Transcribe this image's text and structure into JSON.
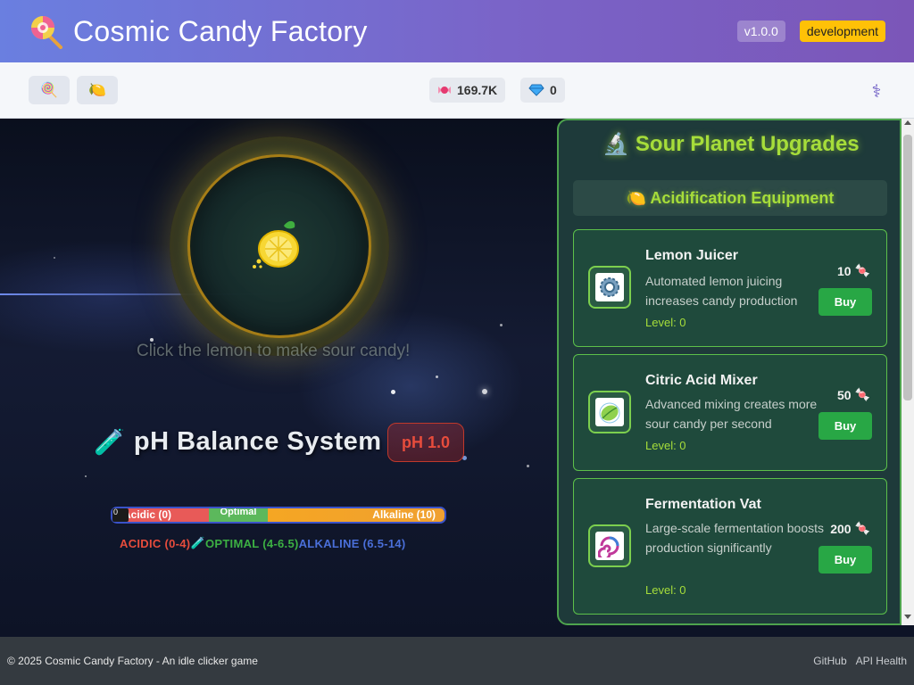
{
  "app": {
    "title": "Cosmic Candy Factory",
    "version": "v1.0.0",
    "environment": "development"
  },
  "toolbar": {
    "planets": [
      {
        "icon": "lollipop-icon",
        "glyph": "🍭"
      },
      {
        "icon": "lemon-icon",
        "glyph": "🍋"
      }
    ],
    "candy_count": "169.7K",
    "gem_count": "0",
    "settings_icon": "caduceus-icon"
  },
  "game": {
    "hint": "Click the lemon to make sour candy!",
    "ph_system": {
      "title": "pH Balance System",
      "value_label": "pH 1.0",
      "ph_value": 1.0,
      "bar_acidic": "Acidic (0)",
      "bar_optimal": "Optimal",
      "bar_alkaline": "Alkaline (10)",
      "marker_text": "0",
      "legend_acidic": "ACIDIC (0-4)",
      "legend_optimal": "OPTIMAL (4-6.5)",
      "legend_alkaline": "ALKALINE (6.5-14)"
    }
  },
  "upgrades": {
    "title": "🔬 Sour Planet Upgrades",
    "section": "🍋 Acidification Equipment",
    "items": [
      {
        "name": "Lemon Juicer",
        "description": "Automated lemon juicing increases candy production",
        "level": "Level: 0",
        "cost": "10",
        "buy_label": "Buy",
        "icon": "gear-icon"
      },
      {
        "name": "Citric Acid Mixer",
        "description": "Advanced mixing creates more sour candy per second",
        "level": "Level: 0",
        "cost": "50",
        "buy_label": "Buy",
        "icon": "leaf-icon"
      },
      {
        "name": "Fermentation Vat",
        "description": "Large-scale fermentation boosts production significantly",
        "level": "Level: 0",
        "cost": "200",
        "buy_label": "Buy",
        "icon": "swirl-icon"
      }
    ]
  },
  "footer": {
    "copyright": "© 2025 Cosmic Candy Factory - An idle clicker game",
    "link_github": "GitHub",
    "link_health": "API Health"
  },
  "colors": {
    "header_start": "#6a7fe0",
    "header_end": "#7b56b8",
    "accent_green": "#a6dd3a",
    "buy_green": "#28a745",
    "acidic": "#e74c3c",
    "optimal": "#5cb85c",
    "alkaline": "#f5a623"
  }
}
